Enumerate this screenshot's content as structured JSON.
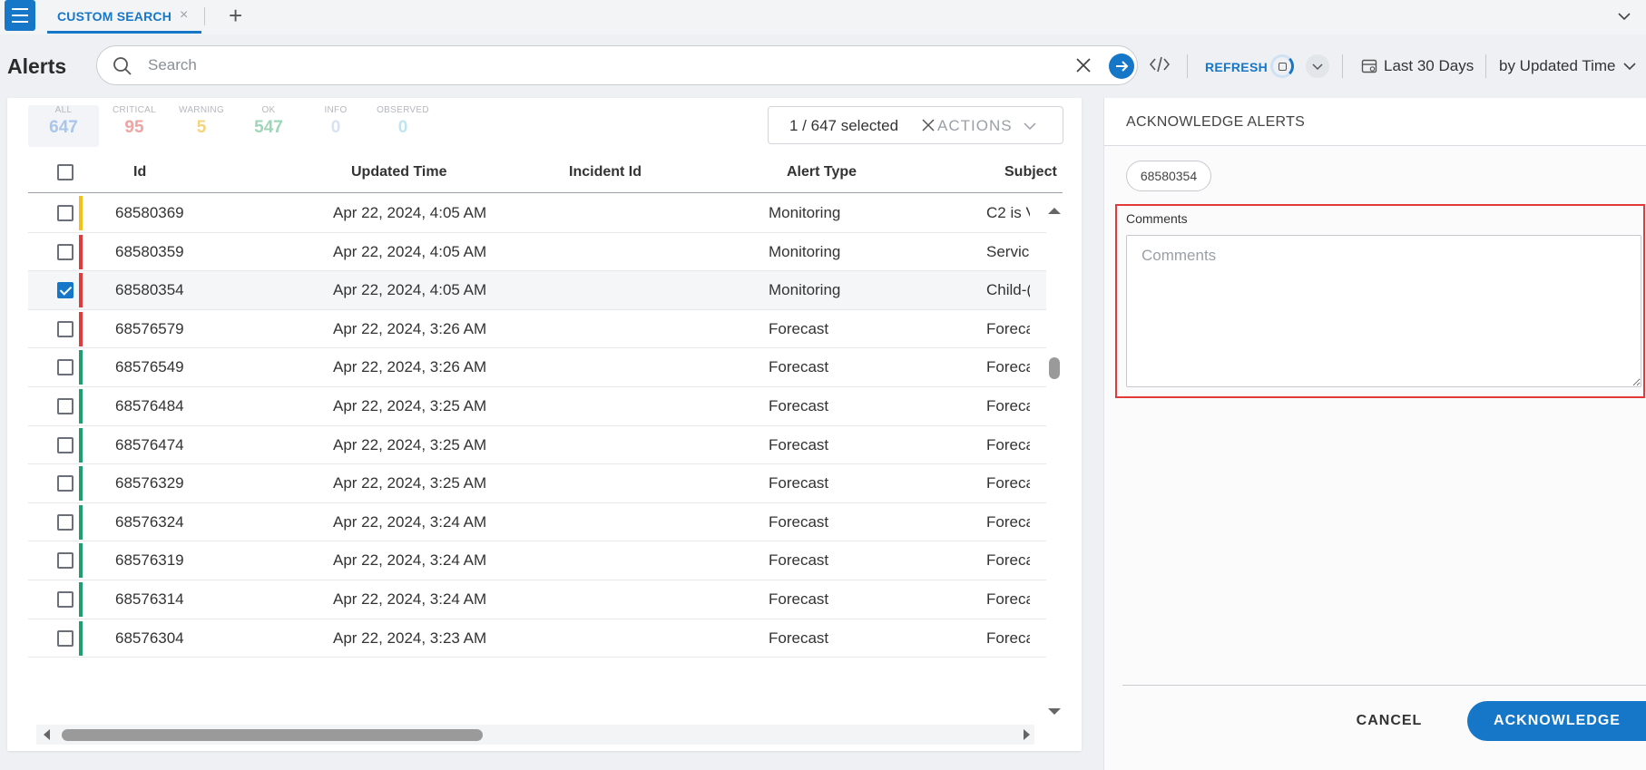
{
  "tabs": {
    "menu_icon": "hamburger-menu-icon",
    "active_tab": "CUSTOM SEARCH",
    "close_glyph": "×",
    "add_glyph": "+"
  },
  "header": {
    "title": "Alerts",
    "search_placeholder": "Search",
    "search_value": "",
    "refresh_label": "REFRESH",
    "date_range": "Last 30 Days",
    "sort_by": "by Updated Time"
  },
  "stats": [
    {
      "label": "ALL",
      "value": "647",
      "color": "#a9c6ea"
    },
    {
      "label": "CRITICAL",
      "value": "95",
      "color": "#f0a3a3"
    },
    {
      "label": "WARNING",
      "value": "5",
      "color": "#f6d47a"
    },
    {
      "label": "OK",
      "value": "547",
      "color": "#9fd6b8"
    },
    {
      "label": "INFO",
      "value": "0",
      "color": "#d8e2f0"
    },
    {
      "label": "OBSERVED",
      "value": "0",
      "color": "#bfe6f0"
    }
  ],
  "selection": {
    "text": "1 / 647 selected",
    "actions_label": "ACTIONS"
  },
  "table": {
    "columns": [
      "Id",
      "Updated Time",
      "Incident Id",
      "Alert Type",
      "Subject"
    ],
    "severity_colors": {
      "critical": "#e03a3a",
      "warning": "#f2c21b",
      "ok": "#1f9e6e"
    },
    "rows": [
      {
        "id": "68580369",
        "updated": "Apr 22, 2024, 4:05 AM",
        "incident": "",
        "type": "Monitoring",
        "subject": "C2 is V",
        "severity": "warning",
        "checked": false
      },
      {
        "id": "68580359",
        "updated": "Apr 22, 2024, 4:05 AM",
        "incident": "",
        "type": "Monitoring",
        "subject": "Service",
        "severity": "critical",
        "checked": false
      },
      {
        "id": "68580354",
        "updated": "Apr 22, 2024, 4:05 AM",
        "incident": "",
        "type": "Monitoring",
        "subject": "Child-(",
        "severity": "critical",
        "checked": true
      },
      {
        "id": "68576579",
        "updated": "Apr 22, 2024, 3:26 AM",
        "incident": "",
        "type": "Forecast",
        "subject": "Foreca",
        "severity": "critical",
        "checked": false
      },
      {
        "id": "68576549",
        "updated": "Apr 22, 2024, 3:26 AM",
        "incident": "",
        "type": "Forecast",
        "subject": "Foreca",
        "severity": "ok",
        "checked": false
      },
      {
        "id": "68576484",
        "updated": "Apr 22, 2024, 3:25 AM",
        "incident": "",
        "type": "Forecast",
        "subject": "Foreca",
        "severity": "ok",
        "checked": false
      },
      {
        "id": "68576474",
        "updated": "Apr 22, 2024, 3:25 AM",
        "incident": "",
        "type": "Forecast",
        "subject": "Foreca",
        "severity": "ok",
        "checked": false
      },
      {
        "id": "68576329",
        "updated": "Apr 22, 2024, 3:25 AM",
        "incident": "",
        "type": "Forecast",
        "subject": "Foreca",
        "severity": "ok",
        "checked": false
      },
      {
        "id": "68576324",
        "updated": "Apr 22, 2024, 3:24 AM",
        "incident": "",
        "type": "Forecast",
        "subject": "Foreca",
        "severity": "ok",
        "checked": false
      },
      {
        "id": "68576319",
        "updated": "Apr 22, 2024, 3:24 AM",
        "incident": "",
        "type": "Forecast",
        "subject": "Foreca",
        "severity": "ok",
        "checked": false
      },
      {
        "id": "68576314",
        "updated": "Apr 22, 2024, 3:24 AM",
        "incident": "",
        "type": "Forecast",
        "subject": "Foreca",
        "severity": "ok",
        "checked": false
      },
      {
        "id": "68576304",
        "updated": "Apr 22, 2024, 3:23 AM",
        "incident": "",
        "type": "Forecast",
        "subject": "Foreca",
        "severity": "ok",
        "checked": false
      }
    ]
  },
  "panel": {
    "title": "ACKNOWLEDGE ALERTS",
    "chip": "68580354",
    "comments_label": "Comments",
    "comments_placeholder": "Comments",
    "comments_value": "",
    "cancel_label": "CANCEL",
    "acknowledge_label": "ACKNOWLEDGE"
  },
  "colors": {
    "accent": "#1677c9",
    "highlight_frame": "#e03a3a"
  }
}
